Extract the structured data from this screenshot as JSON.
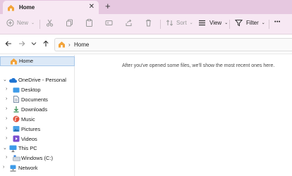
{
  "tab": {
    "title": "Home",
    "close_glyph": "✕",
    "new_tab_glyph": "+"
  },
  "toolbar": {
    "new_label": "New",
    "sort_label": "Sort",
    "view_label": "View",
    "filter_label": "Filter",
    "more_glyph": "•••"
  },
  "address": {
    "separator": "›",
    "crumb": "Home"
  },
  "sidebar": {
    "home": "Home",
    "onedrive": "OneDrive - Personal",
    "desktop": "Desktop",
    "documents": "Documents",
    "downloads": "Downloads",
    "music": "Music",
    "pictures": "Pictures",
    "videos": "Videos",
    "this_pc": "This PC",
    "windows_c": "Windows (C:)",
    "network": "Network"
  },
  "content": {
    "empty_message": "After you've opened some files, we'll show the most recent ones here."
  },
  "colors": {
    "titlebar": "#e6c8e0",
    "command_bar": "#f7e8f3",
    "selection": "#dce9f7",
    "accent": "#2a7de1"
  }
}
